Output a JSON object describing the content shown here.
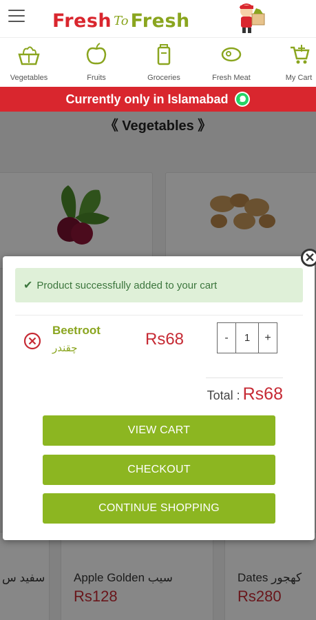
{
  "header": {
    "logo_part1": "Fresh",
    "logo_part2": "To",
    "logo_part3": "Fresh",
    "menu_icon": "hamburger-menu-icon"
  },
  "categories": [
    {
      "label": "Vegetables",
      "icon": "vegetable-basket-icon"
    },
    {
      "label": "Fruits",
      "icon": "apple-icon"
    },
    {
      "label": "Groceries",
      "icon": "grocery-bag-icon"
    },
    {
      "label": "Fresh Meat",
      "icon": "meat-icon"
    },
    {
      "label": "My Cart",
      "icon": "cart-icon"
    }
  ],
  "banner": {
    "text": "Currently only in Islamabad",
    "icon": "whatsapp-icon"
  },
  "page": {
    "section_title": "《 Vegetables 》",
    "products": [
      {
        "name": "سفید س",
        "price": ""
      },
      {
        "name": "Apple Golden سیب",
        "price": "Rs128"
      },
      {
        "name": "Dates کھجور",
        "price": "Rs280"
      }
    ]
  },
  "modal": {
    "alert_text": "Product successfully added to your cart",
    "item": {
      "name": "Beetroot",
      "urdu_name": "چقندر",
      "price": "Rs68",
      "qty": "1",
      "minus": "-",
      "plus": "+"
    },
    "total_label": "Total :",
    "total_value": "Rs68",
    "buttons": {
      "view_cart": "VIEW CART",
      "checkout": "CHECKOUT",
      "continue": "CONTINUE SHOPPING"
    },
    "close_glyph": "✕"
  },
  "colors": {
    "brand_red": "#d9262e",
    "brand_green": "#8aa51f",
    "button_green": "#8cb621",
    "price_red": "#c62a34",
    "alert_bg": "#dff0d8"
  }
}
